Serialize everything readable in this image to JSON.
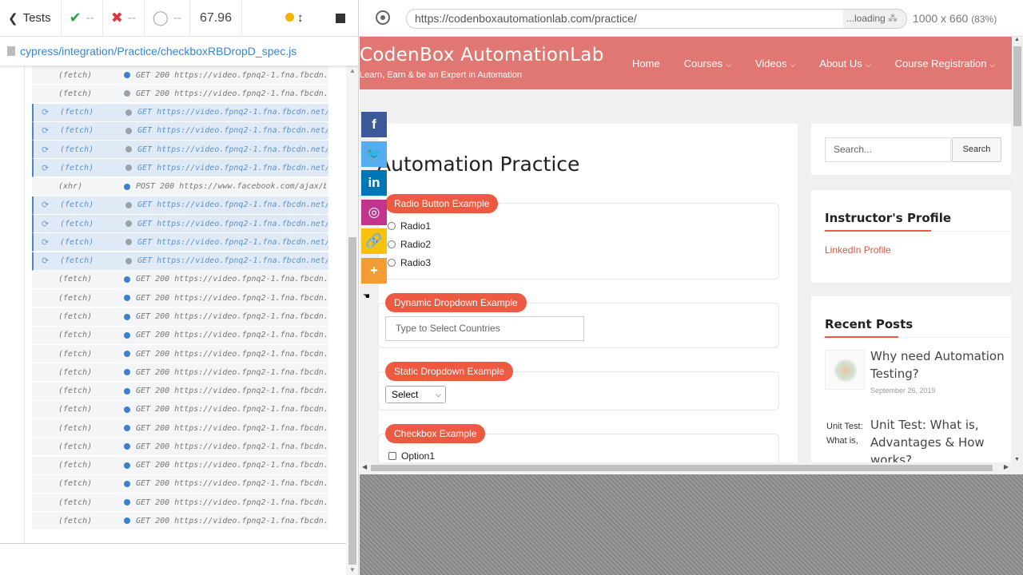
{
  "reporter": {
    "tests_label": "Tests",
    "passed": "--",
    "failed": "--",
    "pending": "--",
    "duration": "67.96",
    "spec_path": "cypress/integration/Practice/checkboxRBDropD_spec.js"
  },
  "commands": [
    {
      "type": "(fetch)",
      "msg": "GET 200 https://video.fpnq2-1.fna.fbcdn.n…",
      "state": "done"
    },
    {
      "type": "(fetch)",
      "msg": "GET 200 https://video.fpnq2-1.fna.fbcdn.n…",
      "state": "grey"
    },
    {
      "type": "(fetch)",
      "msg": "GET https://video.fpnq2-1.fna.fbcdn.net/v…",
      "state": "pending"
    },
    {
      "type": "(fetch)",
      "msg": "GET https://video.fpnq2-1.fna.fbcdn.net/v…",
      "state": "pending"
    },
    {
      "type": "(fetch)",
      "msg": "GET https://video.fpnq2-1.fna.fbcdn.net/v…",
      "state": "pending"
    },
    {
      "type": "(fetch)",
      "msg": "GET https://video.fpnq2-1.fna.fbcdn.net/v…",
      "state": "pending"
    },
    {
      "type": "(xhr)",
      "msg": "POST 200 https://www.facebook.com/ajax/bz…",
      "state": "done"
    },
    {
      "type": "(fetch)",
      "msg": "GET https://video.fpnq2-1.fna.fbcdn.net/v…",
      "state": "pending"
    },
    {
      "type": "(fetch)",
      "msg": "GET https://video.fpnq2-1.fna.fbcdn.net/v…",
      "state": "pending"
    },
    {
      "type": "(fetch)",
      "msg": "GET https://video.fpnq2-1.fna.fbcdn.net/v…",
      "state": "pending"
    },
    {
      "type": "(fetch)",
      "msg": "GET https://video.fpnq2-1.fna.fbcdn.net/v…",
      "state": "pending"
    },
    {
      "type": "(fetch)",
      "msg": "GET 200 https://video.fpnq2-1.fna.fbcdn.n…",
      "state": "done"
    },
    {
      "type": "(fetch)",
      "msg": "GET 200 https://video.fpnq2-1.fna.fbcdn.n…",
      "state": "done"
    },
    {
      "type": "(fetch)",
      "msg": "GET 200 https://video.fpnq2-1.fna.fbcdn.n…",
      "state": "done"
    },
    {
      "type": "(fetch)",
      "msg": "GET 200 https://video.fpnq2-1.fna.fbcdn.n…",
      "state": "done"
    },
    {
      "type": "(fetch)",
      "msg": "GET 200 https://video.fpnq2-1.fna.fbcdn.n…",
      "state": "done"
    },
    {
      "type": "(fetch)",
      "msg": "GET 200 https://video.fpnq2-1.fna.fbcdn.n…",
      "state": "done"
    },
    {
      "type": "(fetch)",
      "msg": "GET 200 https://video.fpnq2-1.fna.fbcdn.n…",
      "state": "done"
    },
    {
      "type": "(fetch)",
      "msg": "GET 200 https://video.fpnq2-1.fna.fbcdn.n…",
      "state": "done"
    },
    {
      "type": "(fetch)",
      "msg": "GET 200 https://video.fpnq2-1.fna.fbcdn.n…",
      "state": "done"
    },
    {
      "type": "(fetch)",
      "msg": "GET 200 https://video.fpnq2-1.fna.fbcdn.n…",
      "state": "done"
    },
    {
      "type": "(fetch)",
      "msg": "GET 200 https://video.fpnq2-1.fna.fbcdn.n…",
      "state": "done"
    },
    {
      "type": "(fetch)",
      "msg": "GET 200 https://video.fpnq2-1.fna.fbcdn.n…",
      "state": "done"
    },
    {
      "type": "(fetch)",
      "msg": "GET 200 https://video.fpnq2-1.fna.fbcdn.n…",
      "state": "done"
    },
    {
      "type": "(fetch)",
      "msg": "GET 200 https://video.fpnq2-1.fna.fbcdn.n…",
      "state": "done"
    }
  ],
  "browser": {
    "url": "https://codenboxautomationlab.com/practice/",
    "loading": "...loading",
    "viewport_size": "1000 x 660",
    "zoom": "(83%)"
  },
  "site": {
    "logo": "CodenBox AutomationLab",
    "tagline": "Learn, Earn & be an Expert in Automation",
    "nav": [
      "Home",
      "Courses",
      "Videos",
      "About Us",
      "Course Registration"
    ],
    "page_title": "Automation Practice",
    "radio_section": "Radio Button Example",
    "radios": [
      "Radio1",
      "Radio2",
      "Radio3"
    ],
    "dynamic_section": "Dynamic Dropdown Example",
    "country_placeholder": "Type to Select Countries",
    "static_section": "Static Dropdown Example",
    "static_selected": "Select",
    "checkbox_section": "Checkbox Example",
    "checkbox1": "Option1",
    "social": [
      {
        "icon": "facebook-icon",
        "glyph": "f",
        "color": "#3b5998"
      },
      {
        "icon": "twitter-icon",
        "glyph": "🐦",
        "color": "#55acee"
      },
      {
        "icon": "linkedin-icon",
        "glyph": "in",
        "color": "#0077b5"
      },
      {
        "icon": "instagram-icon",
        "glyph": "◎",
        "color": "#c1358f"
      },
      {
        "icon": "copy-link-icon",
        "glyph": "🔗",
        "color": "#f6c20e"
      },
      {
        "icon": "more-icon",
        "glyph": "+",
        "color": "#f39c33"
      }
    ]
  },
  "sidebar": {
    "search_placeholder": "Search...",
    "search_button": "Search",
    "profile_title": "Instructor's Profile",
    "profile_link": "LinkedIn Profile",
    "recent_title": "Recent Posts",
    "post1_title": "Why need Automation Testing?",
    "post1_date": "September 26, 2019",
    "post2_alt": "Unit Test: What is,",
    "post2_title": "Unit Test: What is, Advantages & How works?"
  },
  "colors": {
    "header_bg": "#e17772",
    "accent": "#ee5a41",
    "link": "#d15a43"
  }
}
